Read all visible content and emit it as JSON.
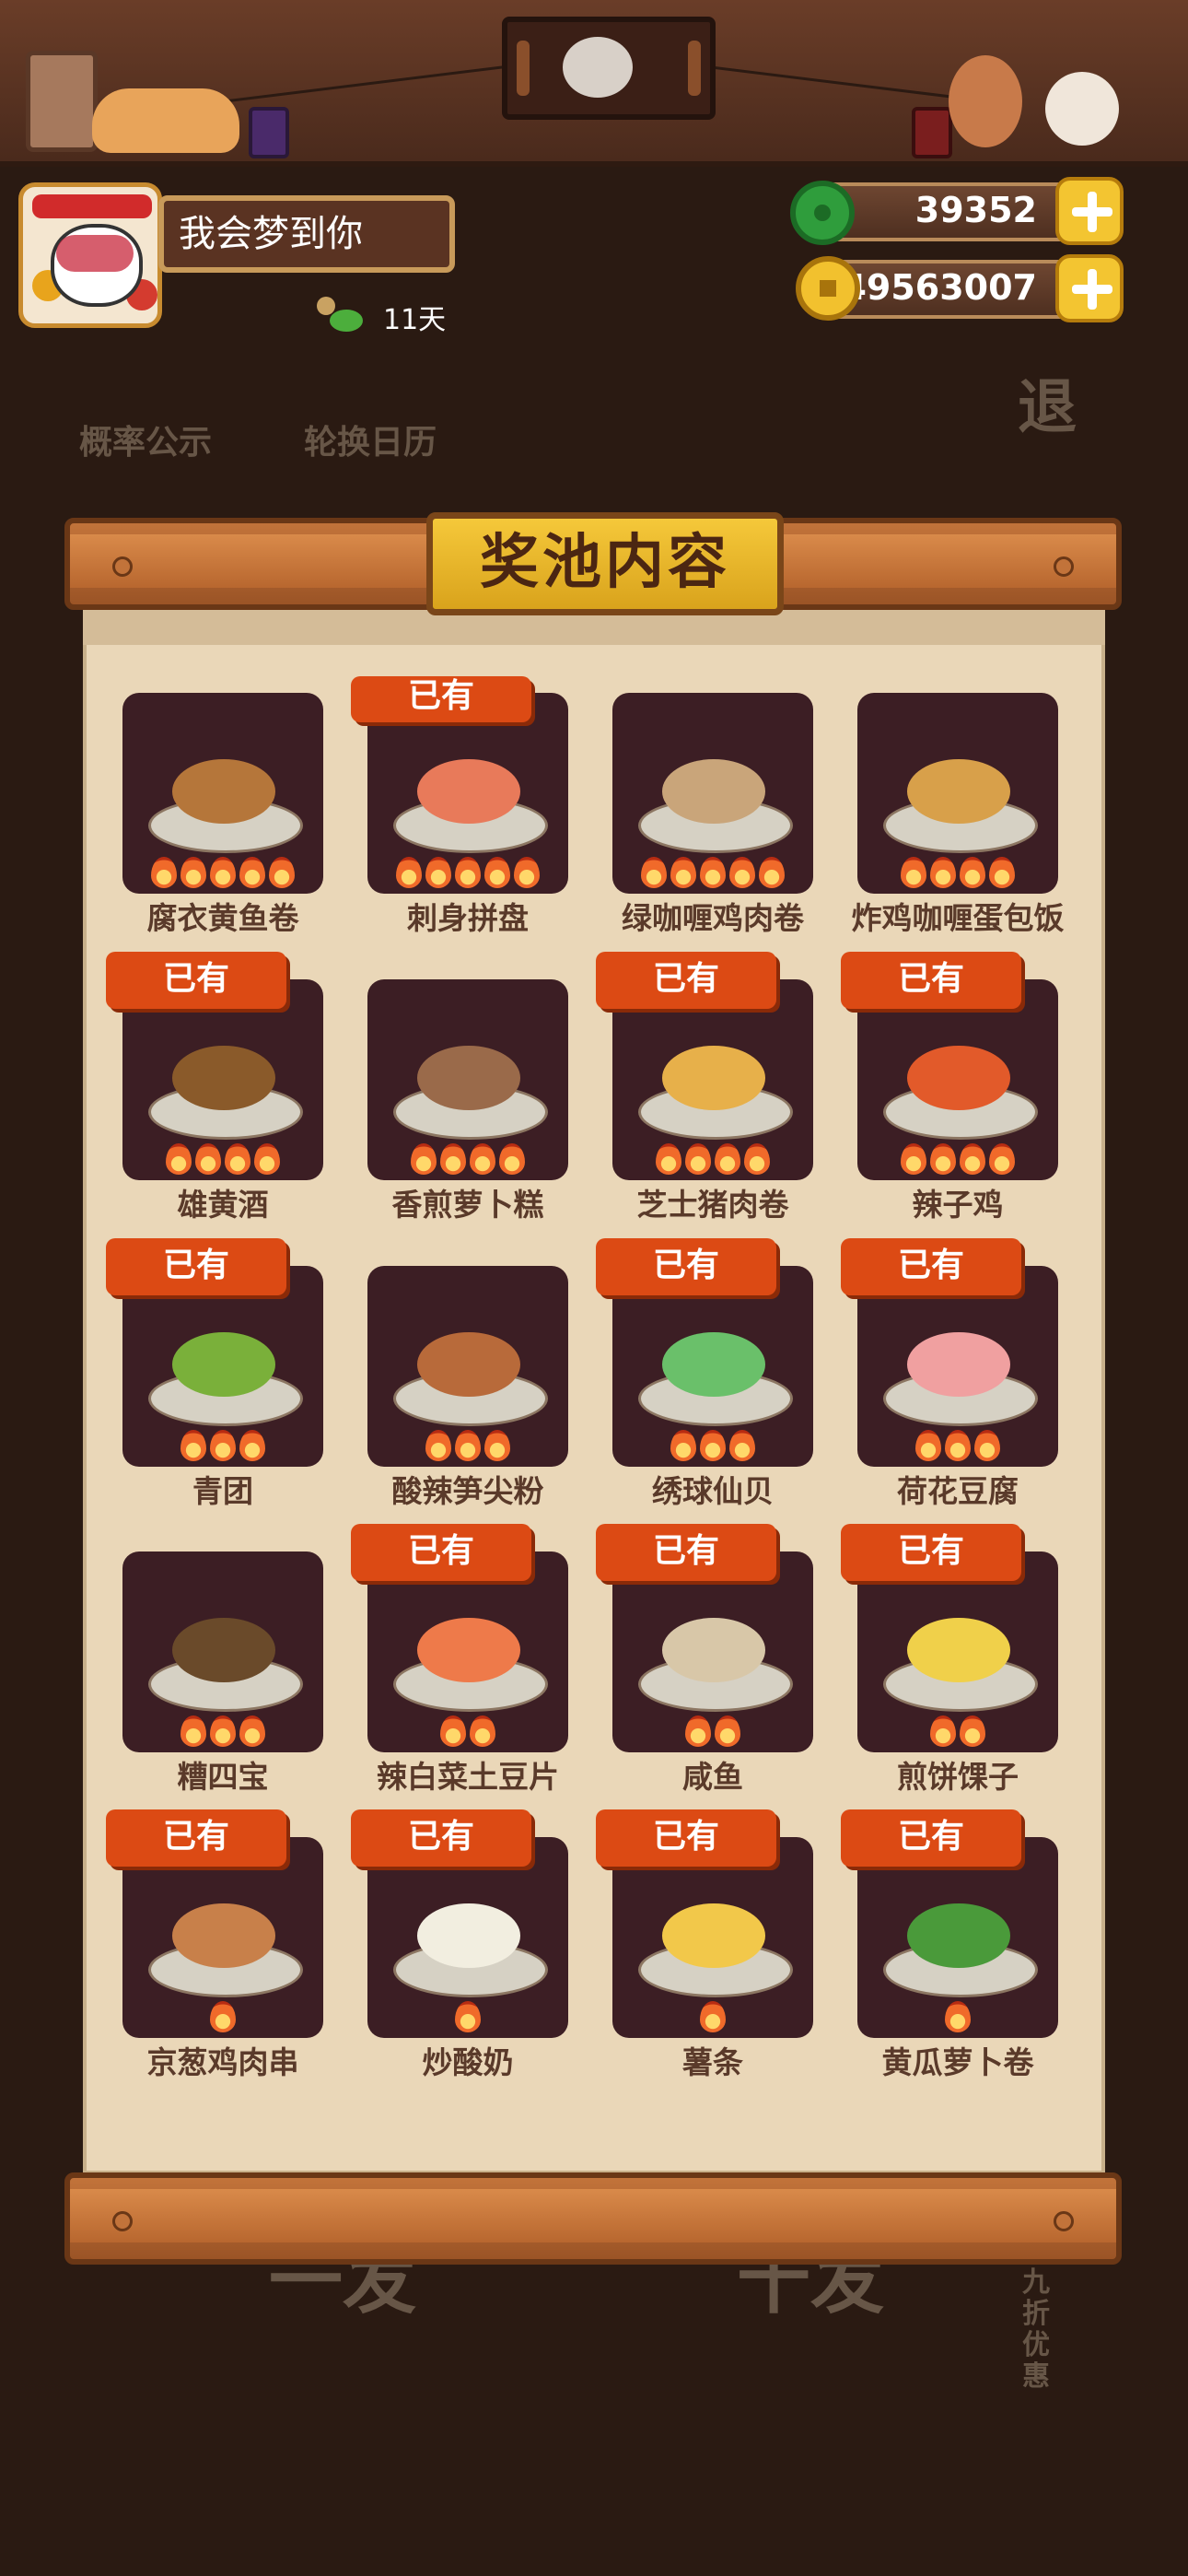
{
  "header": {
    "username": "我会梦到你",
    "days": "11天",
    "jade": "39352",
    "coins": "49563007"
  },
  "background_buttons": {
    "probability": "概率公示",
    "rotation": "轮换日历",
    "back": "退",
    "discount": "九折优惠",
    "one_draw": "一发",
    "ten_draw": "十发"
  },
  "pool": {
    "title": "奖池内容",
    "owned_label": "已有",
    "items": [
      {
        "name": "腐衣黄鱼卷",
        "owned": false,
        "stars": 5,
        "top": "#b5763a"
      },
      {
        "name": "刺身拼盘",
        "owned": true,
        "stars": 5,
        "top": "#e87a5a"
      },
      {
        "name": "绿咖喱鸡肉卷",
        "owned": false,
        "stars": 5,
        "top": "#c9a57a"
      },
      {
        "name": "炸鸡咖喱蛋包饭",
        "owned": false,
        "stars": 4,
        "top": "#d8a04a"
      },
      {
        "name": "雄黄酒",
        "owned": true,
        "stars": 4,
        "top": "#8a5a2a"
      },
      {
        "name": "香煎萝卜糕",
        "owned": false,
        "stars": 4,
        "top": "#9a6a4a"
      },
      {
        "name": "芝士猪肉卷",
        "owned": true,
        "stars": 4,
        "top": "#e7b04a"
      },
      {
        "name": "辣子鸡",
        "owned": true,
        "stars": 4,
        "top": "#e25a2a"
      },
      {
        "name": "青团",
        "owned": true,
        "stars": 3,
        "top": "#7ab03a"
      },
      {
        "name": "酸辣笋尖粉",
        "owned": false,
        "stars": 3,
        "top": "#b86a3a"
      },
      {
        "name": "绣球仙贝",
        "owned": true,
        "stars": 3,
        "top": "#6ac06a"
      },
      {
        "name": "荷花豆腐",
        "owned": true,
        "stars": 3,
        "top": "#f0a0a0"
      },
      {
        "name": "糟四宝",
        "owned": false,
        "stars": 3,
        "top": "#6a4a2a"
      },
      {
        "name": "辣白菜土豆片",
        "owned": true,
        "stars": 2,
        "top": "#ee7a4a"
      },
      {
        "name": "咸鱼",
        "owned": true,
        "stars": 2,
        "top": "#d8c7a8"
      },
      {
        "name": "煎饼馃子",
        "owned": true,
        "stars": 2,
        "top": "#f0d04a"
      },
      {
        "name": "京葱鸡肉串",
        "owned": true,
        "stars": 1,
        "top": "#c8804a"
      },
      {
        "name": "炒酸奶",
        "owned": true,
        "stars": 1,
        "top": "#f2eee0"
      },
      {
        "name": "薯条",
        "owned": true,
        "stars": 1,
        "top": "#f2c84a"
      },
      {
        "name": "黄瓜萝卜卷",
        "owned": true,
        "stars": 1,
        "top": "#4a9a3a"
      }
    ]
  }
}
